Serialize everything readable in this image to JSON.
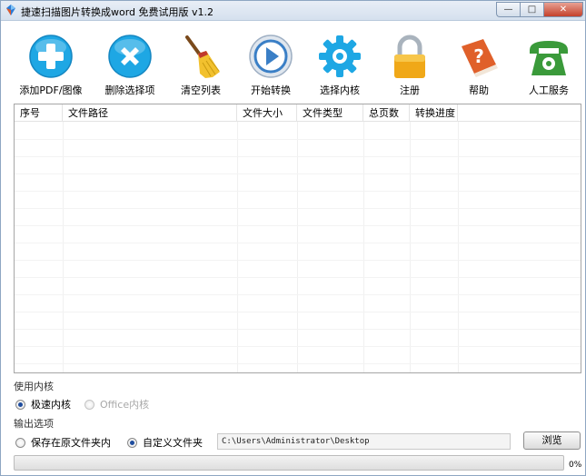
{
  "window": {
    "title": "捷速扫描图片转换成word 免费试用版 v1.2",
    "controls": {
      "minimize": "—",
      "maximize": "□",
      "close": "✕"
    }
  },
  "toolbar": {
    "items": [
      {
        "label": "添加PDF/图像",
        "icon": "add-icon",
        "color": "#1ea7e4"
      },
      {
        "label": "删除选择项",
        "icon": "delete-icon",
        "color": "#1ea7e4"
      },
      {
        "label": "清空列表",
        "icon": "broom-icon",
        "color": "#e5b820"
      },
      {
        "label": "开始转换",
        "icon": "play-icon",
        "color": "#3a7fc6"
      },
      {
        "label": "选择内核",
        "icon": "gear-icon",
        "color": "#1ea7e4"
      },
      {
        "label": "注册",
        "icon": "lock-icon",
        "color": "#f0a818"
      },
      {
        "label": "帮助",
        "icon": "help-book-icon",
        "color": "#e0602a"
      },
      {
        "label": "人工服务",
        "icon": "phone-icon",
        "color": "#3a9a3a"
      }
    ]
  },
  "table": {
    "columns": [
      "序号",
      "文件路径",
      "文件大小",
      "文件类型",
      "总页数",
      "转换进度"
    ],
    "rows": []
  },
  "engine": {
    "title": "使用内核",
    "options": [
      {
        "label": "极速内核",
        "selected": true,
        "enabled": true
      },
      {
        "label": "Office内核",
        "selected": false,
        "enabled": false
      }
    ]
  },
  "output": {
    "title": "输出选项",
    "options": [
      {
        "label": "保存在原文件夹内",
        "selected": false
      },
      {
        "label": "自定义文件夹",
        "selected": true
      }
    ],
    "path": "C:\\Users\\Administrator\\Desktop",
    "browse_label": "浏览"
  },
  "progress": {
    "value": 0,
    "text": "0%"
  }
}
